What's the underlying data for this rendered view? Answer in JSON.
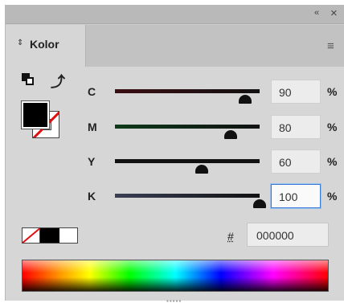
{
  "window": {
    "collapse_glyph": "«",
    "close_glyph": "×"
  },
  "panel": {
    "tab_label": "Kolor",
    "tab_arrows": "⇕"
  },
  "sliders": [
    {
      "label": "C",
      "value": "90",
      "value_num": 90,
      "unit": "%",
      "track_color": "#3a0e12",
      "focused": false
    },
    {
      "label": "M",
      "value": "80",
      "value_num": 80,
      "unit": "%",
      "track_color": "#0d3a1a",
      "focused": false
    },
    {
      "label": "Y",
      "value": "60",
      "value_num": 60,
      "unit": "%",
      "track_color": "#111111",
      "focused": false
    },
    {
      "label": "K",
      "value": "100",
      "value_num": 100,
      "unit": "%",
      "track_color": "#3a3f55",
      "focused": true
    }
  ],
  "hex": {
    "prefix": "#",
    "value": "000000"
  },
  "colors": {
    "fill": "#000000",
    "none_slash": "#e01010",
    "focus_ring": "#3b7bd5"
  },
  "icons": [
    "swap-fill-stroke-icon",
    "swap-arrow-icon",
    "panel-menu-icon",
    "collapse-icon",
    "close-icon"
  ]
}
